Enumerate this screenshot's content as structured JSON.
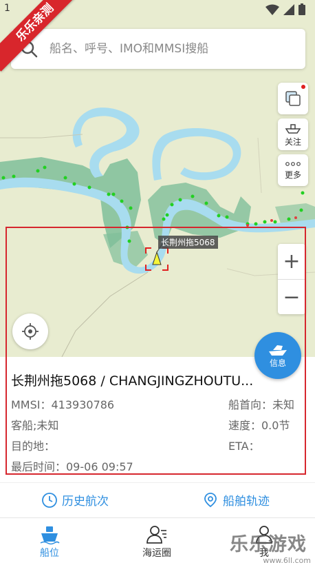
{
  "status_bar": {
    "time": "1"
  },
  "ribbon": {
    "text": "乐乐亲测"
  },
  "search": {
    "placeholder": "船名、呼号、IMO和MMSI搜船"
  },
  "side_buttons": {
    "follow_label": "关注",
    "more_label": "更多"
  },
  "zoom": {
    "in_label": "+",
    "out_label": "−"
  },
  "ship_tag": "长荆州拖5068",
  "info_fab": {
    "label": "信息"
  },
  "ship_card": {
    "title": "长荆州拖5068 / CHANGJINGZHOUTU...",
    "mmsi": "MMSI：413930786",
    "heading": "船首向：未知",
    "type": "客船;未知",
    "speed": "速度：0.0节",
    "destination": "目的地：",
    "eta": "ETA：",
    "last_time": "最后时间：09-06 09:57"
  },
  "actions": {
    "history": "历史航次",
    "track": "船舶轨迹"
  },
  "tabs": [
    {
      "label": "船位",
      "icon": "ship-icon",
      "active": true
    },
    {
      "label": "海运圈",
      "icon": "people-icon",
      "active": false
    },
    {
      "label": "我",
      "icon": "user-icon",
      "active": false
    }
  ],
  "watermark": {
    "text": "乐乐游戏",
    "url": "www.6ll.com"
  },
  "colors": {
    "accent": "#2f8fe0",
    "highlight": "#d6262d",
    "water": "#a8dcef",
    "land": "#e8ecd0",
    "wetland": "#7fbf9a"
  }
}
